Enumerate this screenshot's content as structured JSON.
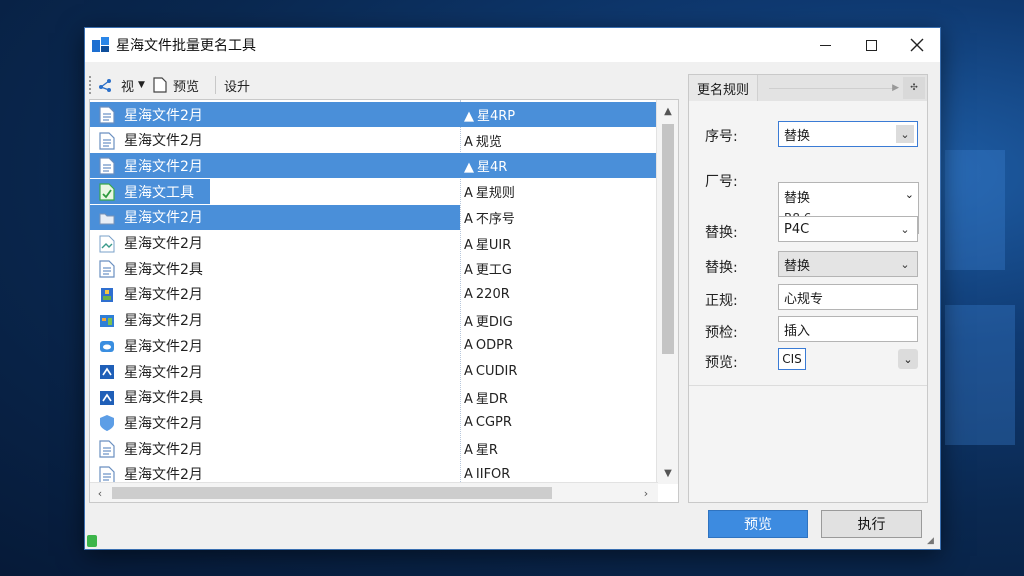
{
  "window": {
    "title": "星海文件批量更名工具"
  },
  "toolbar": {
    "view_label": "视",
    "preview_label": "预览",
    "settings_label": "设升"
  },
  "files": [
    {
      "name": "星海文件2月",
      "new_name": "星4RP",
      "icon": "document-icon",
      "selection": "full"
    },
    {
      "name": "星海文件2月",
      "new_name": "规览",
      "icon": "document-icon",
      "selection": "none"
    },
    {
      "name": "星海文件2月",
      "new_name": "星4R",
      "icon": "document-icon",
      "selection": "full"
    },
    {
      "name": "星海文工具",
      "new_name": "星规则",
      "icon": "green-file-icon",
      "selection": "part"
    },
    {
      "name": "星海文件2月",
      "new_name": "不序号",
      "icon": "folder-icon",
      "selection": "left"
    },
    {
      "name": "星海文件2月",
      "new_name": "星UIR",
      "icon": "image-file-icon",
      "selection": "none"
    },
    {
      "name": "星海文件2具",
      "new_name": "更工G",
      "icon": "document-icon",
      "selection": "none"
    },
    {
      "name": "星海文件2月",
      "new_name": "220R",
      "icon": "archive-icon",
      "selection": "none"
    },
    {
      "name": "星海文件2月",
      "new_name": "更DIG",
      "icon": "app-window-icon",
      "selection": "none"
    },
    {
      "name": "星海文件2月",
      "new_name": "ODPR",
      "icon": "cloud-icon",
      "selection": "none"
    },
    {
      "name": "星海文件2月",
      "new_name": "CUDIR",
      "icon": "blue-app-icon",
      "selection": "none"
    },
    {
      "name": "星海文件2具",
      "new_name": "星DR",
      "icon": "blue-app-icon",
      "selection": "none"
    },
    {
      "name": "星海文件2月",
      "new_name": "CGPR",
      "icon": "shield-file-icon",
      "selection": "none"
    },
    {
      "name": "星海文件2月",
      "new_name": "星R",
      "icon": "document-icon",
      "selection": "none"
    },
    {
      "name": "星海文件2月",
      "new_name": "IIFOR",
      "icon": "document-icon",
      "selection": "none"
    }
  ],
  "side": {
    "header": "更名规则",
    "fields": {
      "seq_label": "序号:",
      "seq_value": "替换",
      "prefix_label": "厂号:",
      "prefix_line1": "替换",
      "prefix_line2": "R8 6",
      "replace1_label": "替换:",
      "replace1_value": "P4C",
      "replace2_label": "替换:",
      "replace2_value": "替换",
      "regex_label": "正规:",
      "regex_value": "心规专",
      "preview_label": "预检:",
      "preview_value": "插入",
      "preview2_label": "预览:",
      "preview2_value": "CIS"
    }
  },
  "buttons": {
    "preview": "预览",
    "run": "执行"
  },
  "colors": {
    "accent": "#3d8be0",
    "selection": "#4a8fd9"
  }
}
